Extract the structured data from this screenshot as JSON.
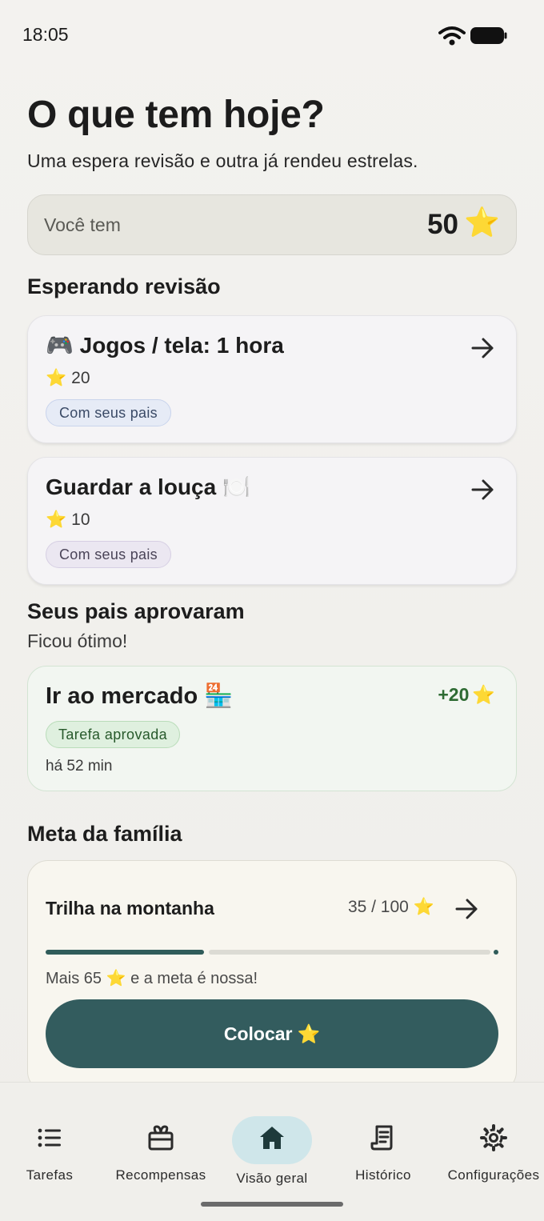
{
  "status_bar": {
    "time": "18:05"
  },
  "header": {
    "title": "O que tem hoje?",
    "subtitle": "Uma espera revisão e outra já rendeu estrelas."
  },
  "balance": {
    "label": "Você tem",
    "value": "50",
    "star": "⭐"
  },
  "pending": {
    "title": "Esperando revisão",
    "items": [
      {
        "title": "🎮 Jogos / tela: 1 hora",
        "stars": "20",
        "chip": "Com seus pais"
      },
      {
        "title": "Guardar a louça 🍽️",
        "stars": "10",
        "chip": "Com seus pais"
      }
    ]
  },
  "approved": {
    "title": "Seus pais aprovaram",
    "subtitle": "Ficou ótimo!",
    "item": {
      "title": "Ir ao mercado 🏪",
      "points": "+20",
      "chip": "Tarefa aprovada",
      "time": "há 52 min"
    }
  },
  "goal": {
    "section_title": "Meta da família",
    "name": "Trilha na montanha",
    "count": "35 / 100",
    "progress": 0.35,
    "message_before": "Mais 65",
    "message_after": "e a meta é nossa!",
    "button": "Colocar"
  },
  "nav": {
    "items": [
      {
        "label": "Tarefas",
        "icon": "list-icon"
      },
      {
        "label": "Recompensas",
        "icon": "gift-icon"
      },
      {
        "label": "Visão geral",
        "icon": "home-icon",
        "active": true
      },
      {
        "label": "Histórico",
        "icon": "receipt-icon"
      },
      {
        "label": "Configurações",
        "icon": "gear-icon"
      }
    ]
  },
  "colors": {
    "accent": "#335c5e",
    "star": "#f4c02a",
    "approved_green": "#2e6b33",
    "nav_active_pill": "#cfe6ea"
  }
}
